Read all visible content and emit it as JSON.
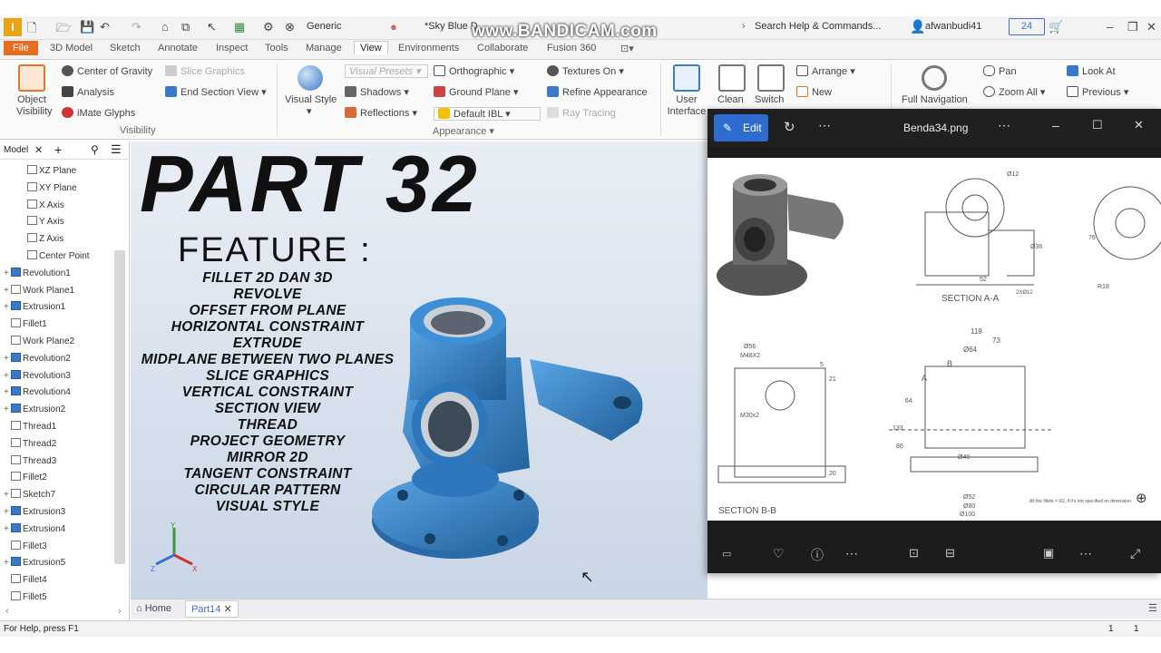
{
  "app": {
    "quick_access": {
      "style_label": "Generic",
      "document_label": "*Sky Blue D"
    },
    "watermark": "www.BANDICAM.com",
    "search_label": "Search Help & Commands...",
    "user": "afwanbudi41",
    "clock_badge": "24",
    "tabs": [
      "File",
      "3D Model",
      "Sketch",
      "Annotate",
      "Inspect",
      "Tools",
      "Manage",
      "View",
      "Environments",
      "Collaborate",
      "Fusion 360"
    ],
    "active_tab": "View"
  },
  "ribbon": {
    "object_visibility": "Object Visibility",
    "center_of_gravity": "Center of Gravity",
    "slice_graphics": "Slice Graphics",
    "analysis": "Analysis",
    "end_section_view": "End Section View",
    "imate_glyphs": "iMate Glyphs",
    "visibility_group": "Visibility",
    "visual_style": "Visual Style",
    "visual_presets": "Visual Presets",
    "orthographic": "Orthographic",
    "textures_on": "Textures On",
    "shadows": "Shadows",
    "ground_plane": "Ground Plane",
    "refine_appearance": "Refine Appearance",
    "reflections": "Reflections",
    "default_ibl": "Default IBL",
    "ray_tracing": "Ray Tracing",
    "appearance_group": "Appearance",
    "user_interface": "User Interface",
    "clean": "Clean",
    "switch": "Switch",
    "arrange": "Arrange",
    "new": "New",
    "full_navigation": "Full Navigation",
    "pan": "Pan",
    "zoom_all": "Zoom All",
    "look_at": "Look At",
    "previous": "Previous"
  },
  "browser": {
    "title": "Model",
    "items": [
      {
        "label": "XZ Plane",
        "type": "plane",
        "expand": ""
      },
      {
        "label": "XY Plane",
        "type": "plane",
        "expand": ""
      },
      {
        "label": "X Axis",
        "type": "axis",
        "expand": ""
      },
      {
        "label": "Y Axis",
        "type": "axis",
        "expand": ""
      },
      {
        "label": "Z Axis",
        "type": "axis",
        "expand": ""
      },
      {
        "label": "Center Point",
        "type": "point",
        "expand": ""
      },
      {
        "label": "Revolution1",
        "type": "solid",
        "expand": "+"
      },
      {
        "label": "Work Plane1",
        "type": "plane",
        "expand": "+"
      },
      {
        "label": "Extrusion1",
        "type": "solid",
        "expand": "+"
      },
      {
        "label": "Fillet1",
        "type": "fillet",
        "expand": ""
      },
      {
        "label": "Work Plane2",
        "type": "plane",
        "expand": ""
      },
      {
        "label": "Revolution2",
        "type": "solid",
        "expand": "+"
      },
      {
        "label": "Revolution3",
        "type": "solid",
        "expand": "+"
      },
      {
        "label": "Revolution4",
        "type": "solid",
        "expand": "+"
      },
      {
        "label": "Extrusion2",
        "type": "solid",
        "expand": "+"
      },
      {
        "label": "Thread1",
        "type": "fillet",
        "expand": ""
      },
      {
        "label": "Thread2",
        "type": "fillet",
        "expand": ""
      },
      {
        "label": "Thread3",
        "type": "fillet",
        "expand": ""
      },
      {
        "label": "Fillet2",
        "type": "fillet",
        "expand": ""
      },
      {
        "label": "Sketch7",
        "type": "sketch",
        "expand": "+"
      },
      {
        "label": "Extrusion3",
        "type": "solid",
        "expand": "+"
      },
      {
        "label": "Extrusion4",
        "type": "solid",
        "expand": "+"
      },
      {
        "label": "Fillet3",
        "type": "fillet",
        "expand": ""
      },
      {
        "label": "Extrusion5",
        "type": "solid",
        "expand": "+"
      },
      {
        "label": "Fillet4",
        "type": "fillet",
        "expand": ""
      },
      {
        "label": "Fillet5",
        "type": "fillet",
        "expand": ""
      }
    ]
  },
  "overlay": {
    "title": "PART 32",
    "subtitle": "FEATURE :",
    "features": [
      "FILLET 2D DAN 3D",
      "REVOLVE",
      "OFFSET FROM PLANE",
      "HORIZONTAL CONSTRAINT",
      "EXTRUDE",
      "MIDPLANE BETWEEN TWO PLANES",
      "SLICE GRAPHICS",
      "VERTICAL CONSTRAINT",
      "SECTION VIEW",
      "THREAD",
      "PROJECT GEOMETRY",
      "MIRROR 2D",
      "TANGENT CONSTRAINT",
      "CIRCULAR PATTERN",
      "VISUAL STYLE"
    ]
  },
  "doc_tabs": {
    "home": "Home",
    "part": "Part14"
  },
  "status": {
    "help": "For Help, press F1",
    "count1": "1",
    "count2": "1"
  },
  "viewer": {
    "edit_label": "Edit",
    "filename": "Benda34.png",
    "drawing": {
      "section_aa": "SECTION A-A",
      "section_bb": "SECTION B-B",
      "note": "All the fillets = R2, if it's not specified on dimension.",
      "dims": {
        "d118": "118",
        "d73": "73",
        "d64": "Ø64",
        "d56": "Ø56",
        "m48": "M48X2",
        "m30": "M30x2",
        "d100": "Ø100",
        "d80": "Ø80",
        "d52": "Ø52",
        "d40": "Ø40",
        "h133": "133",
        "h64": "64",
        "h86": "86",
        "h76": "76",
        "d12": "Ø12",
        "d36": "Ø36",
        "a": "A",
        "b": "B",
        "r18": "R18",
        "h20": "20",
        "h5": "5",
        "h21": "21",
        "h52": "52",
        "x2": "2XØ12"
      }
    }
  },
  "colors": {
    "accent": "#3a78c9",
    "part_blue": "#2f7fc4",
    "file_tab": "#e86d1f",
    "edit_button": "#2f6ccf"
  }
}
